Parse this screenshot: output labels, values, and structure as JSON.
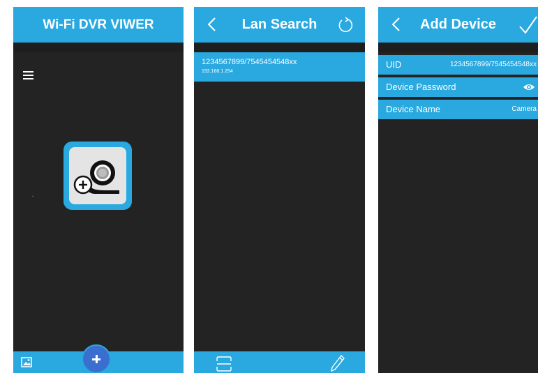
{
  "screen1": {
    "title": "Wi-Fi DVR VIWER",
    "stray_mark": "´",
    "icons": [
      "menu-icon",
      "add-camera-icon",
      "gallery-icon",
      "add-icon"
    ]
  },
  "screen2": {
    "title": "Lan Search",
    "item": {
      "uid": "1234567899/7545454548xx",
      "ip": "192.168.1.254"
    },
    "icons": [
      "back-icon",
      "refresh-icon",
      "scan-icon",
      "edit-icon"
    ]
  },
  "screen3": {
    "title": "Add Device",
    "uid_label": "UID",
    "uid_value": "1234567899/7545454548xx",
    "password_label": "Device Password",
    "name_label": "Device Name",
    "name_value": "Camera",
    "icons": [
      "back-icon",
      "checkmark-icon",
      "eye-icon"
    ]
  },
  "colors": {
    "accent": "#29a9e0",
    "background": "#232323",
    "fab": "#3a6fcf"
  }
}
